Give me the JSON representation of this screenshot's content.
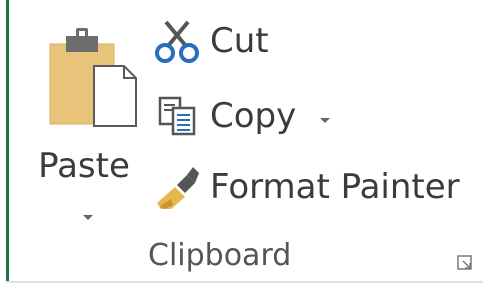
{
  "ribbon": {
    "group_label": "Clipboard",
    "paste_label": "Paste",
    "cut_label": "Cut",
    "copy_label": "Copy",
    "format_painter_label": "Format Painter"
  },
  "icons": {
    "paste": "clipboard-paste-icon",
    "cut": "scissors-icon",
    "copy": "copy-icon",
    "format_painter": "paintbrush-icon",
    "dialog_launcher": "dialog-launcher-icon"
  },
  "colors": {
    "accent_green": "#217346",
    "clipboard_tan": "#e8c47a",
    "clip_gray": "#6d6d6d",
    "scissors_blue": "#2a6ebb",
    "brush_gold": "#e5b84b"
  }
}
